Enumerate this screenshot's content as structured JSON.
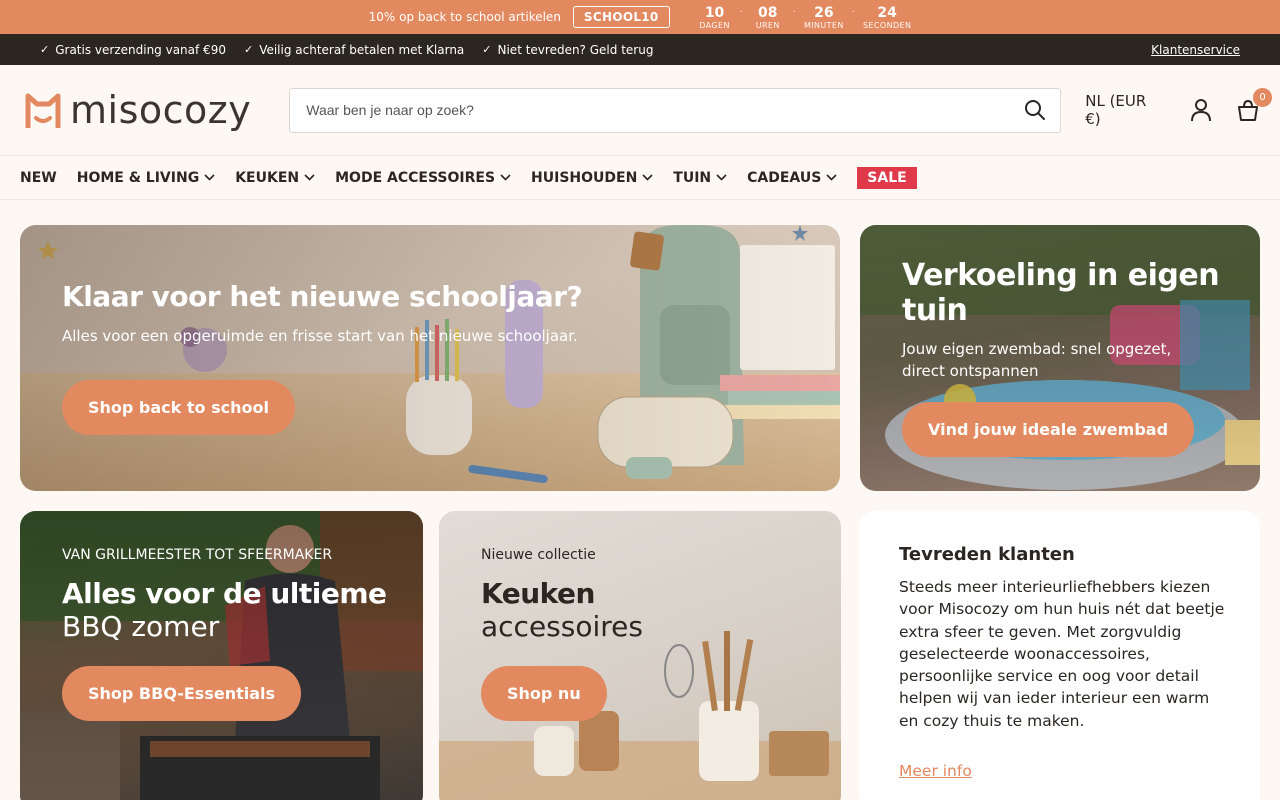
{
  "promo": {
    "text": "10% op back to school artikelen",
    "code": "SCHOOL10",
    "countdown": [
      {
        "value": "10",
        "label": "DAGEN"
      },
      {
        "value": "08",
        "label": "UREN"
      },
      {
        "value": "26",
        "label": "MINUTEN"
      },
      {
        "value": "24",
        "label": "SECONDEN"
      }
    ],
    "separator": "·"
  },
  "usp": {
    "check": "✓",
    "items": [
      "Gratis verzending vanaf €90",
      "Veilig achteraf betalen met Klarna",
      "Niet tevreden? Geld terug"
    ],
    "service": "Klantenservice"
  },
  "header": {
    "logo": "misocozy",
    "search_placeholder": "Waar ben je naar op zoek?",
    "language": "NL (EUR €)",
    "cart_count": "0"
  },
  "nav": {
    "items": [
      {
        "label": "NEW"
      },
      {
        "label": "HOME & LIVING"
      },
      {
        "label": "KEUKEN"
      },
      {
        "label": "MODE ACCESSOIRES"
      },
      {
        "label": "HUISHOUDEN"
      },
      {
        "label": "TUIN"
      },
      {
        "label": "CADEAUS"
      }
    ],
    "sale": "SALE"
  },
  "hero": {
    "title": "Klaar voor het nieuwe schooljaar?",
    "subtitle": "Alles voor een opgeruimde en frisse start van het nieuwe schooljaar.",
    "button": "Shop back to school"
  },
  "pool": {
    "title": "Verkoeling in eigen tuin",
    "subtitle": "Jouw eigen zwembad: snel opgezet, direct ontspannen",
    "button": "Vind jouw ideale zwembad"
  },
  "bbq": {
    "kicker": "VAN GRILLMEESTER TOT SFEERMAKER",
    "title": "Alles voor de ultieme",
    "subtitle": "BBQ zomer",
    "button": "Shop BBQ-Essentials"
  },
  "kitchen": {
    "kicker": "Nieuwe collectie",
    "title": "Keuken",
    "subtitle": "accessoires",
    "button": "Shop nu"
  },
  "reviews": {
    "title": "Tevreden klanten",
    "body": "Steeds meer interieurliefhebbers kiezen voor Misocozy om hun huis nét dat beetje extra sfeer te geven. Met zorgvuldig geselecteerde woonaccessoires, persoonlijke service en oog voor detail helpen wij van ieder interieur een warm en cozy thuis te maken.",
    "link": "Meer info"
  },
  "colors": {
    "accent": "#e3895f",
    "dark": "#2c2620",
    "sale": "#e0394a",
    "background": "#fdf8f4"
  }
}
